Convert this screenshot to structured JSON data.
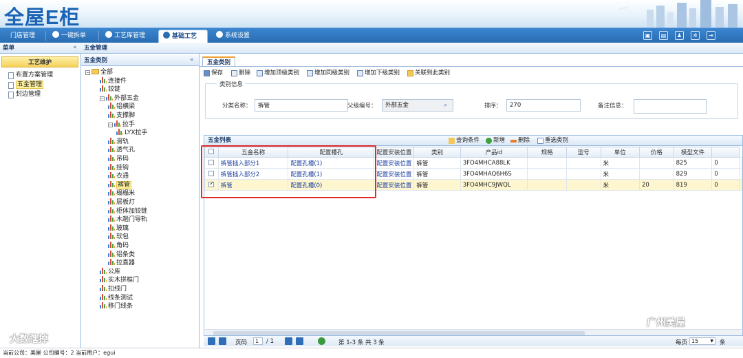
{
  "app": {
    "logo": "全屋E柜"
  },
  "nav": {
    "tabs": [
      "门店管理",
      "一键拆单",
      "工艺库管理",
      "基础工艺",
      "系统设置"
    ],
    "active": 3
  },
  "sidebar": {
    "header": "菜单",
    "group": "工艺维护",
    "items": [
      "布置方案管理",
      "五金管理",
      "封边管理"
    ],
    "selected": 1
  },
  "breadcrumb": "五金管理",
  "tree": {
    "header": "五金类别",
    "nodes": [
      {
        "label": "全部",
        "level": 0,
        "toggle": "⊟",
        "folder": true
      },
      {
        "label": "连接件",
        "level": 1
      },
      {
        "label": "铰链",
        "level": 1
      },
      {
        "label": "外部五金",
        "level": 1,
        "toggle": "⊟"
      },
      {
        "label": "铝横梁",
        "level": 2
      },
      {
        "label": "支撑脚",
        "level": 2
      },
      {
        "label": "拉手",
        "level": 2,
        "toggle": "⊟"
      },
      {
        "label": "LYX拉手",
        "level": 3
      },
      {
        "label": "滑轨",
        "level": 2
      },
      {
        "label": "透气孔",
        "level": 2
      },
      {
        "label": "吊码",
        "level": 2
      },
      {
        "label": "挂钩",
        "level": 2
      },
      {
        "label": "衣通",
        "level": 2
      },
      {
        "label": "裤管",
        "level": 2,
        "selected": true
      },
      {
        "label": "榻榻米",
        "level": 2
      },
      {
        "label": "层板灯",
        "level": 2
      },
      {
        "label": "柜体加铰链",
        "level": 2
      },
      {
        "label": "木趟门导轨",
        "level": 2
      },
      {
        "label": "玻璃",
        "level": 2
      },
      {
        "label": "软包",
        "level": 2
      },
      {
        "label": "角码",
        "level": 2
      },
      {
        "label": "铝条类",
        "level": 2
      },
      {
        "label": "拉直器",
        "level": 2
      },
      {
        "label": "公库",
        "level": 1
      },
      {
        "label": "实木拼框门",
        "level": 1
      },
      {
        "label": "扣线门",
        "level": 1
      },
      {
        "label": "线条测试",
        "level": 1
      },
      {
        "label": "移门线条",
        "level": 1
      }
    ]
  },
  "main": {
    "tab": "五金类别",
    "toolbar": [
      "保存",
      "删除",
      "增加顶级类别",
      "增加同级类别",
      "增加下级类别",
      "关联到此类别"
    ],
    "form": {
      "legend": "类别信息",
      "name_label": "分类名称：",
      "name_value": "裤管",
      "parent_label": "父级编号：",
      "parent_value": "外部五金",
      "sort_label": "排序：",
      "sort_value": "270",
      "remark_label": "备注信息：",
      "remark_value": ""
    },
    "grid": {
      "title": "五金列表",
      "actions": [
        "查询条件",
        "新增",
        "删除",
        "重选类别"
      ],
      "columns": [
        "",
        "五金名称",
        "配置槽孔",
        "配置安装位置",
        "类别",
        "产品id",
        "规格",
        "型号",
        "单位",
        "价格",
        "模型文件",
        ""
      ],
      "rows": [
        {
          "checked": false,
          "cells": [
            "裤管插入部分1",
            "配置孔槽(1)",
            "配置安装位置",
            "裤管",
            "3FO4MHCA88LK",
            "",
            "",
            "米",
            "",
            "825",
            "0"
          ]
        },
        {
          "checked": false,
          "cells": [
            "裤管插入部分2",
            "配置孔槽(1)",
            "配置安装位置",
            "裤管",
            "3FO4MHAQ6H6S",
            "",
            "",
            "米",
            "",
            "829",
            "0"
          ]
        },
        {
          "checked": true,
          "cells": [
            "裤管",
            "配置孔槽(0)",
            "配置安装位置",
            "裤管",
            "3FO4MHC9JWQL",
            "",
            "",
            "米",
            "20",
            "819",
            "0"
          ]
        }
      ]
    },
    "pager": {
      "page_label": "页码",
      "page_value": "1",
      "total_pages": "/ 1",
      "range": "第 1-3 条  共 3 条",
      "per_page_label": "每页",
      "per_page_value": "15",
      "unit": "条"
    }
  },
  "status": {
    "text": "当前公司：美屋   公司编号：2   当前用户：egui"
  },
  "watermarks": {
    "left": "大数瞎掉",
    "right": "广州美屋"
  }
}
